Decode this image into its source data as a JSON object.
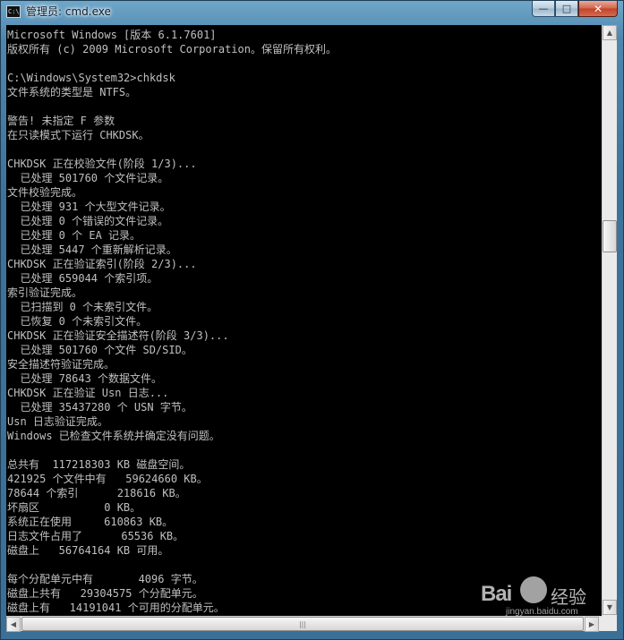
{
  "window": {
    "title": "管理员: cmd.exe",
    "app_icon_glyph": "C:\\",
    "buttons": {
      "minimize": "—",
      "maximize": "□",
      "close": "✕"
    }
  },
  "console": {
    "lines": [
      "Microsoft Windows [版本 6.1.7601]",
      "版权所有 (c) 2009 Microsoft Corporation。保留所有权利。",
      "",
      "C:\\Windows\\System32>chkdsk",
      "文件系统的类型是 NTFS。",
      "",
      "警告! 未指定 F 参数",
      "在只读模式下运行 CHKDSK。",
      "",
      "CHKDSK 正在校验文件(阶段 1/3)...",
      "  已处理 501760 个文件记录。",
      "文件校验完成。",
      "  已处理 931 个大型文件记录。",
      "  已处理 0 个错误的文件记录。",
      "  已处理 0 个 EA 记录。",
      "  已处理 5447 个重新解析记录。",
      "CHKDSK 正在验证索引(阶段 2/3)...",
      "  已处理 659044 个索引项。",
      "索引验证完成。",
      "  已扫描到 0 个未索引文件。",
      "  已恢复 0 个未索引文件。",
      "CHKDSK 正在验证安全描述符(阶段 3/3)...",
      "  已处理 501760 个文件 SD/SID。",
      "安全描述符验证完成。",
      "  已处理 78643 个数据文件。",
      "CHKDSK 正在验证 Usn 日志...",
      "  已处理 35437280 个 USN 字节。",
      "Usn 日志验证完成。",
      "Windows 已检查文件系统并确定没有问题。",
      "",
      "总共有  117218303 KB 磁盘空间。",
      "421925 个文件中有   59624660 KB。",
      "78644 个索引      218616 KB。",
      "坏扇区          0 KB。",
      "系统正在使用     610863 KB。",
      "日志文件占用了      65536 KB。",
      "磁盘上   56764164 KB 可用。",
      "",
      "每个分配单元中有       4096 字节。",
      "磁盘上共有   29304575 个分配单元。",
      "磁盘上有   14191041 个可用的分配单元。"
    ]
  },
  "scrollbars": {
    "vertical": {
      "up_arrow": "▲",
      "down_arrow": "▼"
    },
    "horizontal": {
      "left_arrow": "◀",
      "right_arrow": "▶",
      "grip": "|||"
    }
  },
  "watermark": {
    "logo": "Bai",
    "brand": "经验",
    "url": "jingyan.baidu.com"
  },
  "colors": {
    "console_bg": "#000000",
    "console_text": "#c0c0c0",
    "frame": "#3e7399",
    "close_button": "#c1432b"
  }
}
